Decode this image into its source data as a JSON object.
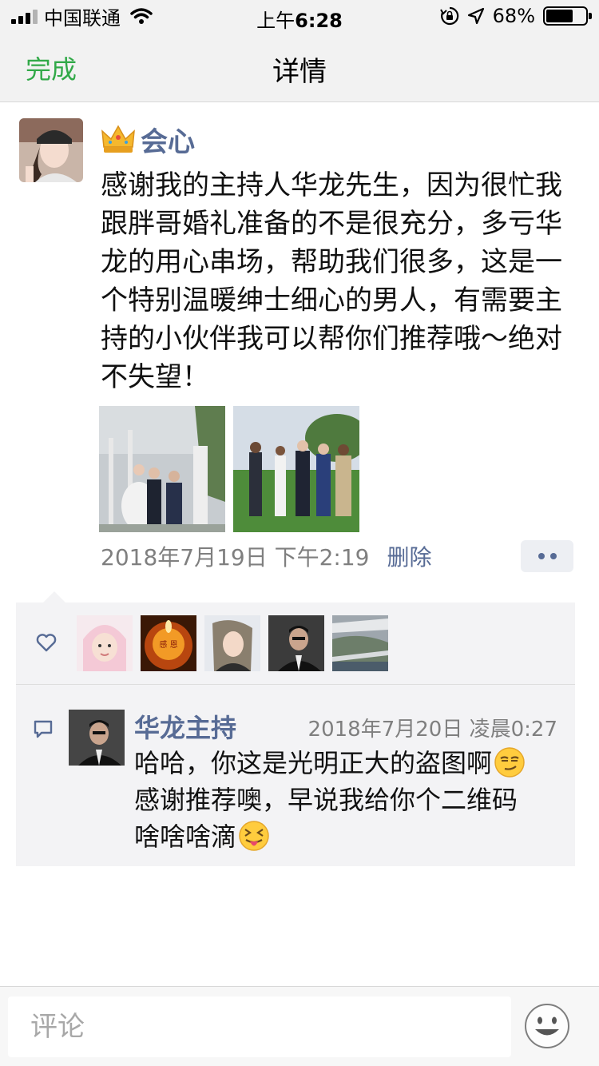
{
  "status_bar": {
    "carrier": "中国联通",
    "time_prefix": "上午",
    "time": "6:28",
    "battery_percent": "68%",
    "battery_level": 0.68
  },
  "nav": {
    "done_label": "完成",
    "title": "详情"
  },
  "post": {
    "author": "会心",
    "text": "感谢我的主持人华龙先生，因为很忙我跟胖哥婚礼准备的不是很充分，多亏华龙的用心串场，帮助我们很多，这是一个特别温暖绅士细心的男人，有需要主持的小伙伴我可以帮你们推荐哦～绝对不失望！",
    "photos": [
      "wedding-photo-stage",
      "wedding-photo-lawn"
    ],
    "timestamp": "2018年7月19日 下午2:19",
    "delete_label": "删除"
  },
  "likes": {
    "avatars": [
      "liker-avatar-1",
      "liker-avatar-2",
      "liker-avatar-3",
      "liker-avatar-4",
      "liker-avatar-5"
    ],
    "candle_text": "感 恩"
  },
  "comment": {
    "author": "华龙主持",
    "time": "2018年7月20日 凌晨0:27",
    "line1": "哈哈，你这是光明正大的盗图啊",
    "line2": "感谢推荐噢，早说我给你个二维码",
    "line3": "啥啥啥滴"
  },
  "input": {
    "placeholder": "评论"
  },
  "colors": {
    "accent_green": "#31a948",
    "link_blue": "#576b95",
    "panel_bg": "#f3f3f5",
    "bar_bg": "#f2f2f2"
  }
}
